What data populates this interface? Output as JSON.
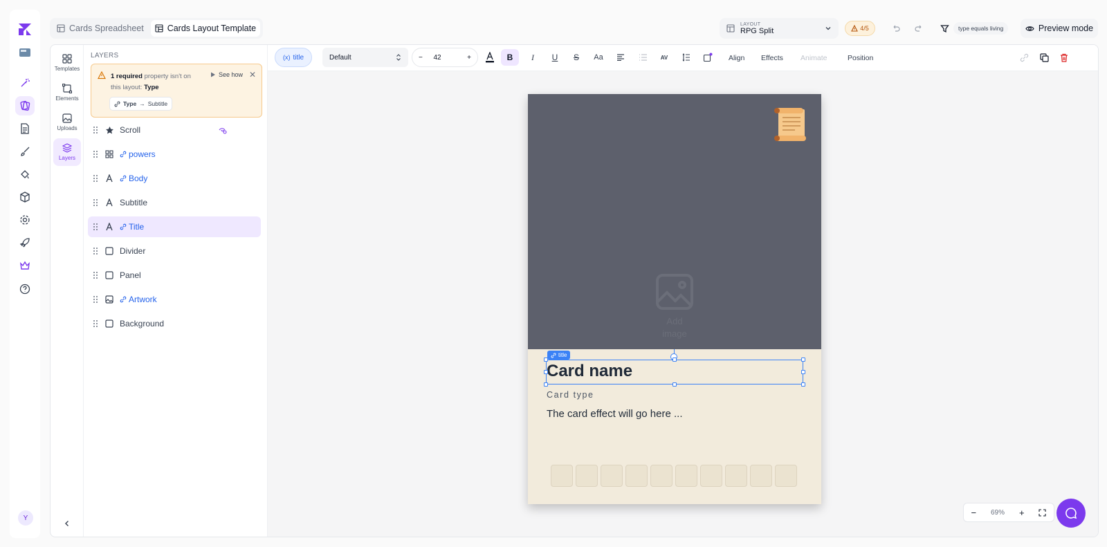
{
  "tabs": [
    {
      "label": "Cards Spreadsheet",
      "active": false
    },
    {
      "label": "Cards Layout Template",
      "active": true
    }
  ],
  "layout": {
    "small_label": "LAYOUT",
    "value": "RPG Split"
  },
  "warnings_badge": "4/5",
  "filter_text": "type equals living",
  "preview_label": "Preview mode",
  "icon_column": {
    "templates": "Templates",
    "elements": "Elements",
    "uploads": "Uploads",
    "layers": "Layers"
  },
  "layers_panel": {
    "title": "LAYERS",
    "warning": {
      "count_text": "1 required",
      "message_mid": "property isn't on this layout:",
      "property": "Type",
      "see_how": "See how",
      "mapping_from": "Type",
      "mapping_to": "Subtitle"
    },
    "items": [
      {
        "label": "Scroll",
        "linked": false,
        "icon": "star-icon"
      },
      {
        "label": "powers",
        "linked": true,
        "icon": "grid-icon"
      },
      {
        "label": "Body",
        "linked": true,
        "icon": "text-icon"
      },
      {
        "label": "Subtitle",
        "linked": false,
        "icon": "text-icon"
      },
      {
        "label": "Title",
        "linked": true,
        "icon": "text-icon",
        "selected": true
      },
      {
        "label": "Divider",
        "linked": false,
        "icon": "square-icon"
      },
      {
        "label": "Panel",
        "linked": false,
        "icon": "square-icon"
      },
      {
        "label": "Artwork",
        "linked": true,
        "icon": "image-icon"
      },
      {
        "label": "Background",
        "linked": false,
        "icon": "square-icon"
      }
    ]
  },
  "toolbar": {
    "variable_label": "title",
    "font": "Default",
    "size": "42",
    "align": "Align",
    "effects": "Effects",
    "animate": "Animate",
    "position": "Position"
  },
  "card": {
    "add_image": "Add image",
    "selection_tag": "title",
    "name": "Card name",
    "type": "Card type",
    "body": "The card effect will go here ...",
    "pip_count": 10
  },
  "zoom": "69%",
  "user_initial": "Y",
  "colors": {
    "accent": "#7c3aed",
    "link": "#2563eb",
    "selection": "#3b82f6",
    "warning_bg": "#fdf3e2"
  }
}
